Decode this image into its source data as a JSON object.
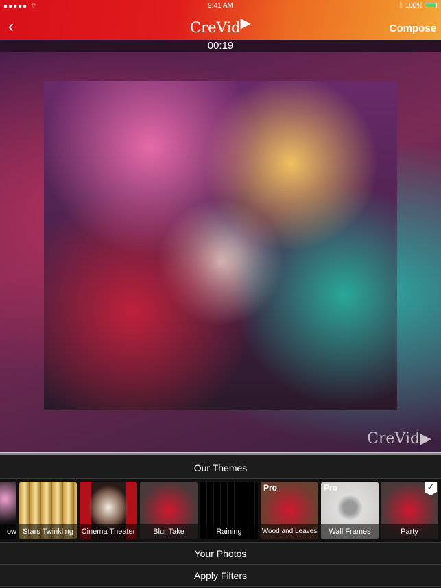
{
  "status": {
    "signal": "●●●●●",
    "wifi_icon": "wifi-icon",
    "time": "9:41 AM",
    "battery": "100%"
  },
  "nav": {
    "back_icon": "chevron-left-icon",
    "title": "CreVid",
    "compose": "Compose"
  },
  "player": {
    "timestamp": "00:19",
    "watermark": "CreVid"
  },
  "themes": {
    "header": "Our Themes",
    "items": [
      {
        "label": "ow",
        "pro": false,
        "selected": false
      },
      {
        "label": "Stars Twinkling",
        "pro": false,
        "selected": false
      },
      {
        "label": "Cinema Theater",
        "pro": false,
        "selected": false
      },
      {
        "label": "Blur Take",
        "pro": false,
        "selected": false
      },
      {
        "label": "Raining",
        "pro": false,
        "selected": false
      },
      {
        "label": "Wood and Leaves",
        "pro": true,
        "selected": false
      },
      {
        "label": "Wall Frames",
        "pro": true,
        "selected": false
      },
      {
        "label": "Party",
        "pro": false,
        "selected": true
      }
    ],
    "pro_badge": "Pro"
  },
  "sections": {
    "photos": "Your Photos",
    "filters": "Apply Filters"
  }
}
